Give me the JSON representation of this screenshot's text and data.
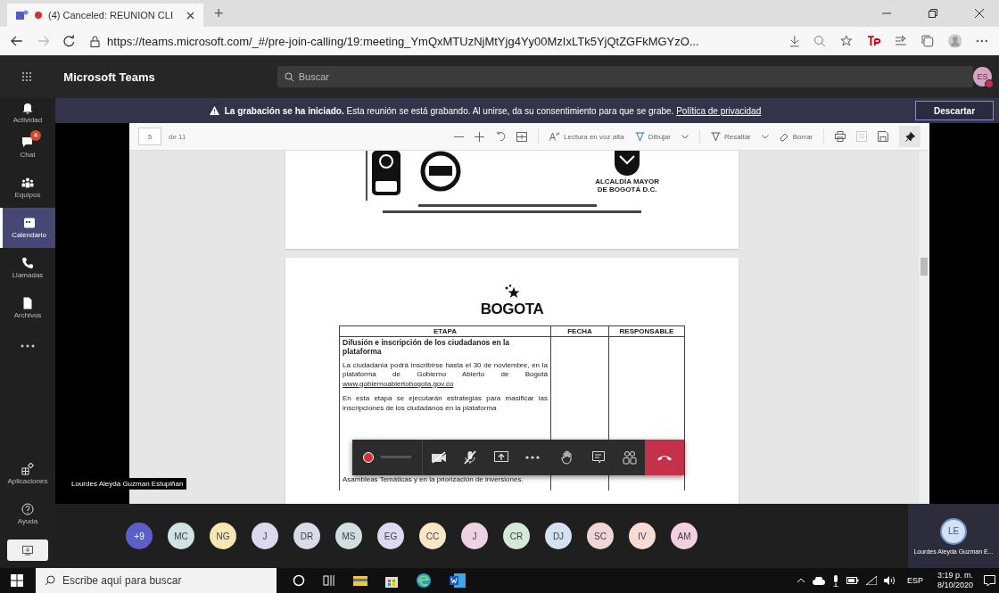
{
  "browser": {
    "tab": {
      "title": "(4) Canceled: REUNION CLI",
      "recording": true
    },
    "new_tab": "+",
    "url": "https://teams.microsoft.com/_#/pre-join-calling/19:meeting_YmQxMTUzNjMtYjg4Yy00MzIxLTk5YjQtZGFkMGYzO..."
  },
  "teams": {
    "title": "Microsoft Teams",
    "search_placeholder": "Buscar",
    "user_initials": "ES"
  },
  "banner": {
    "text": "**La grabación se ha iniciado.** Esta reunión se está grabando. Al unirse, da su consentimiento para que se grabe.",
    "link": "Política de privacidad",
    "button": "Descartar"
  },
  "rail": {
    "items": [
      {
        "kind": "bell",
        "label": "Actividad",
        "selected": false
      },
      {
        "kind": "chat",
        "label": "Chat",
        "selected": false,
        "badge": "4"
      },
      {
        "kind": "teams",
        "label": "Equipos",
        "selected": false
      },
      {
        "kind": "calendar",
        "label": "Calendario",
        "selected": true
      },
      {
        "kind": "phone",
        "label": "Llamadas",
        "selected": false
      },
      {
        "kind": "file",
        "label": "Archivos",
        "selected": false
      }
    ],
    "bottom_items": [
      {
        "kind": "apps",
        "label": "Aplicaciones",
        "selected": false
      },
      {
        "kind": "help",
        "label": "Ayuda",
        "selected": false
      }
    ]
  },
  "viewer": {
    "page": "5",
    "page_count": "de 11",
    "tools": [
      {
        "kind": "read",
        "label": "Lectura en voz alta",
        "dropdown": false
      },
      {
        "kind": "draw",
        "label": "Dibujar",
        "dropdown": true
      },
      {
        "kind": "highlight",
        "label": "Resaltar",
        "dropdown": true
      },
      {
        "kind": "erase",
        "label": "Borrar",
        "dropdown": false
      }
    ]
  },
  "document": {
    "seal_text": [
      "ALCALDÍA MAYOR",
      "DE BOGOTÁ D.C."
    ],
    "logo": "BOGOTA",
    "table": {
      "columns": [
        "ETAPA",
        "FECHA",
        "RESPONSABLE"
      ],
      "title": "Difusión e inscripción de los ciudadanos en la plataforma",
      "paragraph_1": "La ciudadanía podrá inscribirse hasta el 30 de noviembre, en la plataforma de Gobierno Abierto de Bogotá",
      "link": "www.gobiernoabiertobogota.gov.co",
      "paragraph_2": "En esta etapa se ejecutarán estrategias para masificar las inscripciones de los ciudadanos en la plataforma",
      "paragraph_3": "Asambleas Temáticas y en la priorización de inversiones."
    }
  },
  "speaker": "Lourdes Aleyda Guzman Estupiñan",
  "call_controls": {
    "recording": true,
    "camera_on": false,
    "mic_on": false
  },
  "participants": [
    {
      "initials": "+9",
      "color": "#5b5fc7"
    },
    {
      "initials": "MC",
      "color": "#cfe3e3"
    },
    {
      "initials": "NG",
      "color": "#f6e6b4"
    },
    {
      "initials": "J",
      "color": "#dcd9ef"
    },
    {
      "initials": "DR",
      "color": "#d8dce9"
    },
    {
      "initials": "MS",
      "color": "#cfe0e0"
    },
    {
      "initials": "EG",
      "color": "#dcdaf0"
    },
    {
      "initials": "CC",
      "color": "#f7e7c6"
    },
    {
      "initials": "J",
      "color": "#ebd3e3"
    },
    {
      "initials": "CR",
      "color": "#d4ead8"
    },
    {
      "initials": "DJ",
      "color": "#d3e2f3"
    },
    {
      "initials": "SC",
      "color": "#efd6d6"
    },
    {
      "initials": "IV",
      "color": "#f6dcd3"
    },
    {
      "initials": "AM",
      "color": "#f1d0e0"
    }
  ],
  "self": {
    "initials": "LE",
    "name": "Lourdes Aleyda Guzman E..."
  },
  "taskbar": {
    "search_placeholder": "Escribe aquí para buscar",
    "language": "ESP",
    "time": "3:19 p. m.",
    "date": "8/10/2020"
  }
}
